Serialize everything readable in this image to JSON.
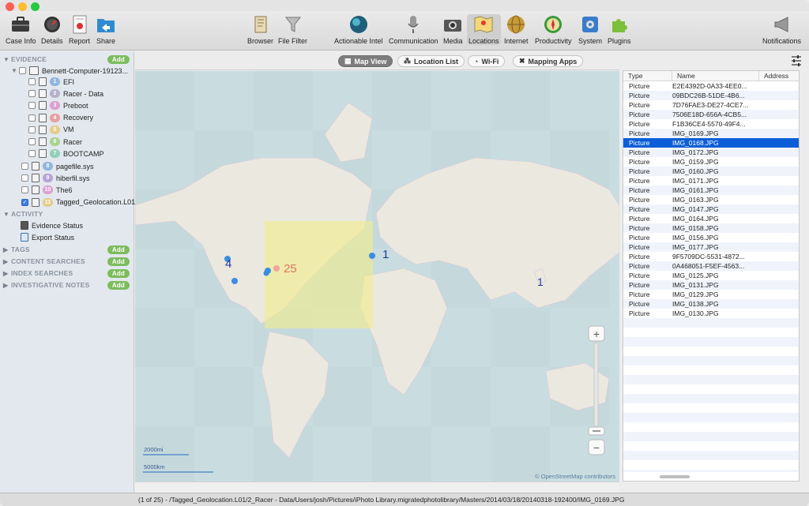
{
  "window": {
    "traffic_lights": {
      "close": "#fe5f57",
      "minimize": "#febc2e",
      "zoom": "#28c840"
    }
  },
  "toolbar": {
    "left": [
      {
        "label": "Case Info",
        "icon": "briefcase-icon"
      },
      {
        "label": "Details",
        "icon": "gauge-icon"
      },
      {
        "label": "Report",
        "icon": "report-icon"
      },
      {
        "label": "Share",
        "icon": "share-folder-icon"
      }
    ],
    "center": [
      {
        "label": "Browser",
        "icon": "browser-icon"
      },
      {
        "label": "File Filter",
        "icon": "funnel-icon"
      },
      {
        "label": "Actionable Intel",
        "icon": "globe-sphere-icon"
      },
      {
        "label": "Communication",
        "icon": "microphone-icon"
      },
      {
        "label": "Media",
        "icon": "media-icon"
      },
      {
        "label": "Locations",
        "icon": "map-icon"
      },
      {
        "label": "Internet",
        "icon": "globe-icon"
      },
      {
        "label": "Productivity",
        "icon": "compass-icon"
      },
      {
        "label": "System",
        "icon": "system-icon"
      },
      {
        "label": "Plugins",
        "icon": "puzzle-icon"
      }
    ],
    "right": {
      "label": "Notifications",
      "icon": "megaphone-icon"
    }
  },
  "sidebar": {
    "evidence": {
      "title": "EVIDENCE",
      "add": "Add",
      "computer": "Bennett-Computer-19123...",
      "items": [
        {
          "num": "1",
          "label": "EFI",
          "color": "#8fb6dd"
        },
        {
          "num": "2",
          "label": "Racer - Data",
          "color": "#b5b0cc"
        },
        {
          "num": "3",
          "label": "Preboot",
          "color": "#dca0d0"
        },
        {
          "num": "4",
          "label": "Recovery",
          "color": "#e5a0a0"
        },
        {
          "num": "5",
          "label": "VM",
          "color": "#e6cc8c"
        },
        {
          "num": "6",
          "label": "Racer",
          "color": "#a8d48f"
        },
        {
          "num": "7",
          "label": "BOOTCAMP",
          "color": "#93cfb8"
        }
      ],
      "files": [
        {
          "num": "8",
          "label": "pagefile.sys",
          "color": "#8fb6dd"
        },
        {
          "num": "9",
          "label": "hiberfil.sys",
          "color": "#b5a3d6"
        },
        {
          "num": "10",
          "label": "The6",
          "color": "#dca0d0"
        },
        {
          "num": "11",
          "label": "Tagged_Geolocation.L01",
          "color": "#e6cc8c"
        }
      ]
    },
    "activity": {
      "title": "ACTIVITY",
      "items": [
        "Evidence Status",
        "Export Status"
      ]
    },
    "sections": [
      {
        "title": "TAGS",
        "add": "Add"
      },
      {
        "title": "CONTENT SEARCHES",
        "add": "Add"
      },
      {
        "title": "INDEX SEARCHES",
        "add": "Add"
      },
      {
        "title": "INVESTIGATIVE NOTES",
        "add": "Add"
      }
    ]
  },
  "map_tabs": [
    "Map View",
    "Location List",
    "Wi-Fi",
    "Mapping Apps"
  ],
  "map": {
    "cluster_labels": [
      "4",
      "25",
      "1",
      "1"
    ],
    "scale_mi": "2000mi",
    "scale_km": "5000km",
    "attribution": "© OpenStreetMap contributors",
    "zoom_in": "+",
    "zoom_out": "−"
  },
  "table": {
    "headers": [
      "Type",
      "Name",
      "Address"
    ],
    "selected_index": 6,
    "rows": [
      [
        "Picture",
        "E2E4392D-0A33-4EE0..."
      ],
      [
        "Picture",
        "09BDC26B-51DE-4B6..."
      ],
      [
        "Picture",
        "7D76FAE3-DE27-4CE7..."
      ],
      [
        "Picture",
        "7506E18D-656A-4CB5..."
      ],
      [
        "Picture",
        "F1B36CE4-5570-49F4..."
      ],
      [
        "Picture",
        "IMG_0169.JPG"
      ],
      [
        "Picture",
        "IMG_0168.JPG"
      ],
      [
        "Picture",
        "IMG_0172.JPG"
      ],
      [
        "Picture",
        "IMG_0159.JPG"
      ],
      [
        "Picture",
        "IMG_0160.JPG"
      ],
      [
        "Picture",
        "IMG_0171.JPG"
      ],
      [
        "Picture",
        "IMG_0161.JPG"
      ],
      [
        "Picture",
        "IMG_0163.JPG"
      ],
      [
        "Picture",
        "IMG_0147.JPG"
      ],
      [
        "Picture",
        "IMG_0164.JPG"
      ],
      [
        "Picture",
        "IMG_0158.JPG"
      ],
      [
        "Picture",
        "IMG_0156.JPG"
      ],
      [
        "Picture",
        "IMG_0177.JPG"
      ],
      [
        "Picture",
        "9F5709DC-5531-4872..."
      ],
      [
        "Picture",
        "0A468051-F5EF-4563..."
      ],
      [
        "Picture",
        "IMG_0125.JPG"
      ],
      [
        "Picture",
        "IMG_0131.JPG"
      ],
      [
        "Picture",
        "IMG_0129.JPG"
      ],
      [
        "Picture",
        "IMG_0138.JPG"
      ],
      [
        "Picture",
        "IMG_0130.JPG"
      ]
    ]
  },
  "status": "(1 of 25)  -  /Tagged_Geolocation.L01/2_Racer - Data/Users/josh/Pictures/iPhoto Library.migratedphotolibrary/Masters/2014/03/18/20140318-192400/IMG_0169.JPG"
}
